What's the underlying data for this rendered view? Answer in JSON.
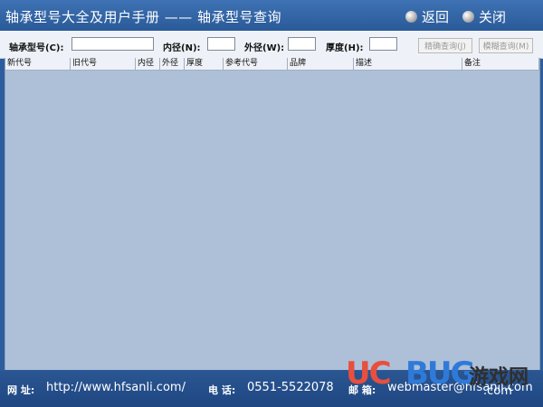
{
  "window": {
    "title": "轴承型号大全及用户手册 —— 轴承型号查询",
    "back_label": "返回",
    "close_label": "关闭"
  },
  "search": {
    "model_label": "轴承型号(C):",
    "inner_label": "内径(N):",
    "outer_label": "外径(W):",
    "thickness_label": "厚度(H):",
    "model_value": "",
    "inner_value": "",
    "outer_value": "",
    "thickness_value": "",
    "exact_button": "精确查询(J)",
    "fuzzy_button": "模糊查询(M)"
  },
  "table": {
    "columns": [
      "新代号",
      "旧代号",
      "内径",
      "外径",
      "厚度",
      "参考代号",
      "品牌",
      "描述",
      "备注"
    ],
    "rows": []
  },
  "footer": {
    "website_label": "网 址:",
    "website": "http://www.hfsanli.com/",
    "phone_label": "电 话:",
    "phone": "0551-5522078",
    "email_label": "邮 箱:",
    "email": "webmaster@hfsanli.com"
  },
  "watermark": {
    "uc": "UC",
    "bug": "BUG",
    "cn": "游戏网",
    "com": ".com"
  },
  "colors": {
    "titlebar": "#2d5d9c",
    "grid_background": "#aebfd8",
    "footer": "#244e8a"
  }
}
